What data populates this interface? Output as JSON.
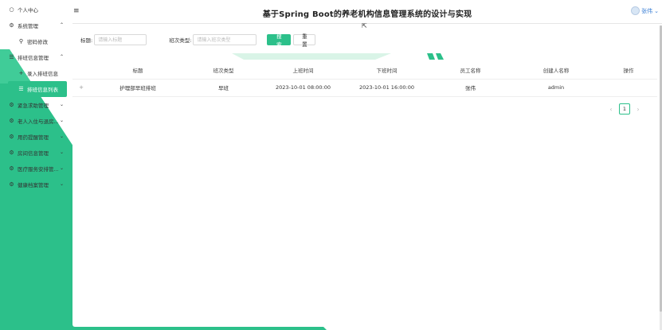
{
  "colors": {
    "accent": "#2cc08a",
    "accent_light": "#a8e6cc",
    "user_link": "#3a7fd5"
  },
  "header": {
    "title": "基于Spring Boot的养老机构信息管理系统的设计与实现",
    "menu_icon": "hamburger-icon",
    "user_name": "张伟"
  },
  "sidebar": {
    "items": [
      {
        "label": "个人中心",
        "icon": "user-icon"
      },
      {
        "label": "系统管理",
        "icon": "gear-icon",
        "expanded": true
      },
      {
        "label": "密码修改",
        "icon": "key-icon",
        "level": 2
      },
      {
        "label": "排班信息管理",
        "icon": "list-icon",
        "expanded": true
      },
      {
        "label": "录入排班信息",
        "icon": "plus-icon",
        "level": 2
      },
      {
        "label": "排班信息列表",
        "icon": "list-icon",
        "level": 2,
        "active": true
      },
      {
        "label": "紧急求助管理",
        "icon": "gear-icon"
      },
      {
        "label": "老人入住与退房...",
        "icon": "gear-icon"
      },
      {
        "label": "用药提醒管理",
        "icon": "gear-icon"
      },
      {
        "label": "房间信息管理",
        "icon": "gear-icon"
      },
      {
        "label": "医疗服务安排管...",
        "icon": "gear-icon"
      },
      {
        "label": "健康档案管理",
        "icon": "gear-icon"
      }
    ]
  },
  "search": {
    "title_label": "标题:",
    "title_placeholder": "请输入标题",
    "type_label": "班次类型:",
    "type_placeholder": "请输入班次类型",
    "search_button": "搜 索",
    "reset_button": "重 置"
  },
  "table": {
    "columns": [
      "",
      "标题",
      "班次类型",
      "上班时间",
      "下班时间",
      "员工名称",
      "创建人名称",
      "操作"
    ],
    "rows": [
      [
        "+",
        "护理部早班排班",
        "早班",
        "2023-10-01 08:00:00",
        "2023-10-01 16:00:00",
        "张伟",
        "admin",
        ""
      ]
    ]
  },
  "pagination": {
    "current_page": "1",
    "prev": "‹",
    "next": "›"
  }
}
